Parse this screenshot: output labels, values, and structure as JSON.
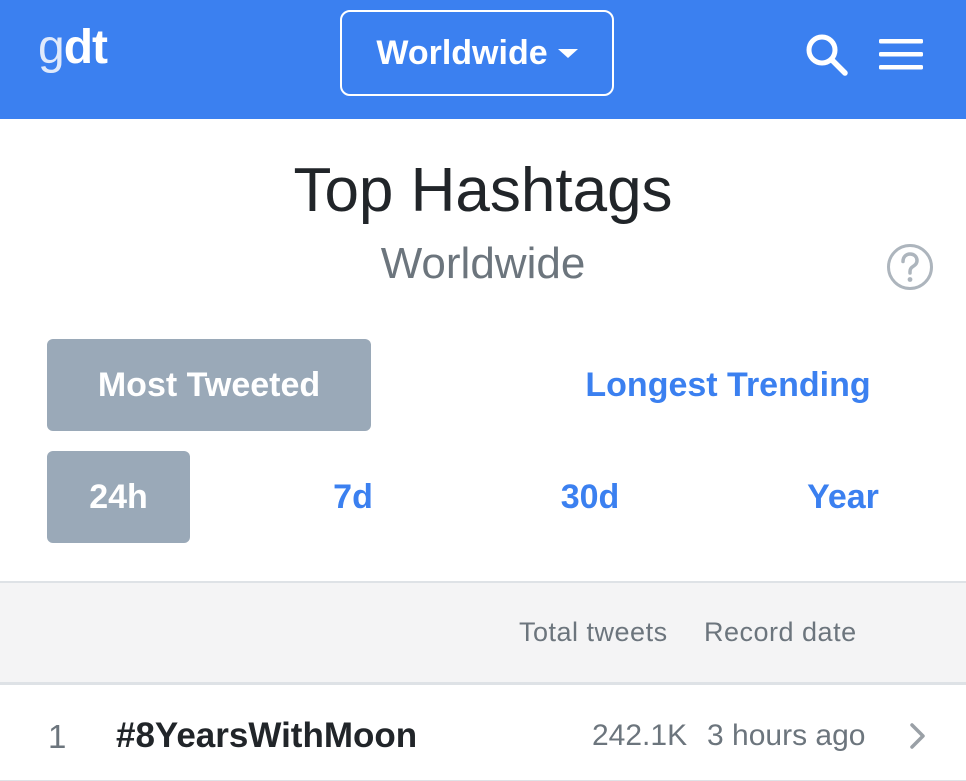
{
  "brand": {
    "logo_g": "g",
    "logo_dt": "dt"
  },
  "header": {
    "region_label": "Worldwide"
  },
  "page": {
    "title": "Top Hashtags",
    "subtitle": "Worldwide"
  },
  "sort_tabs": {
    "most_tweeted": "Most Tweeted",
    "longest_trending": "Longest Trending",
    "active": "Most Tweeted"
  },
  "period_tabs": {
    "h24": "24h",
    "d7": "7d",
    "d30": "30d",
    "year": "Year",
    "active": "24h"
  },
  "table": {
    "col_total": "Total tweets",
    "col_date": "Record date",
    "rows": [
      {
        "rank": "1",
        "hashtag": "#8YearsWithMoon",
        "total": "242.1K",
        "date": "3 hours ago"
      }
    ]
  },
  "icons": {
    "search": "search-icon",
    "menu": "hamburger-menu-icon",
    "help": "question-circle-icon",
    "chevron": "chevron-right-icon",
    "caret": "caret-down-icon"
  },
  "colors": {
    "brand": "#3b80f0",
    "active_segment": "#9aa9b8",
    "link": "#3b80f0"
  }
}
